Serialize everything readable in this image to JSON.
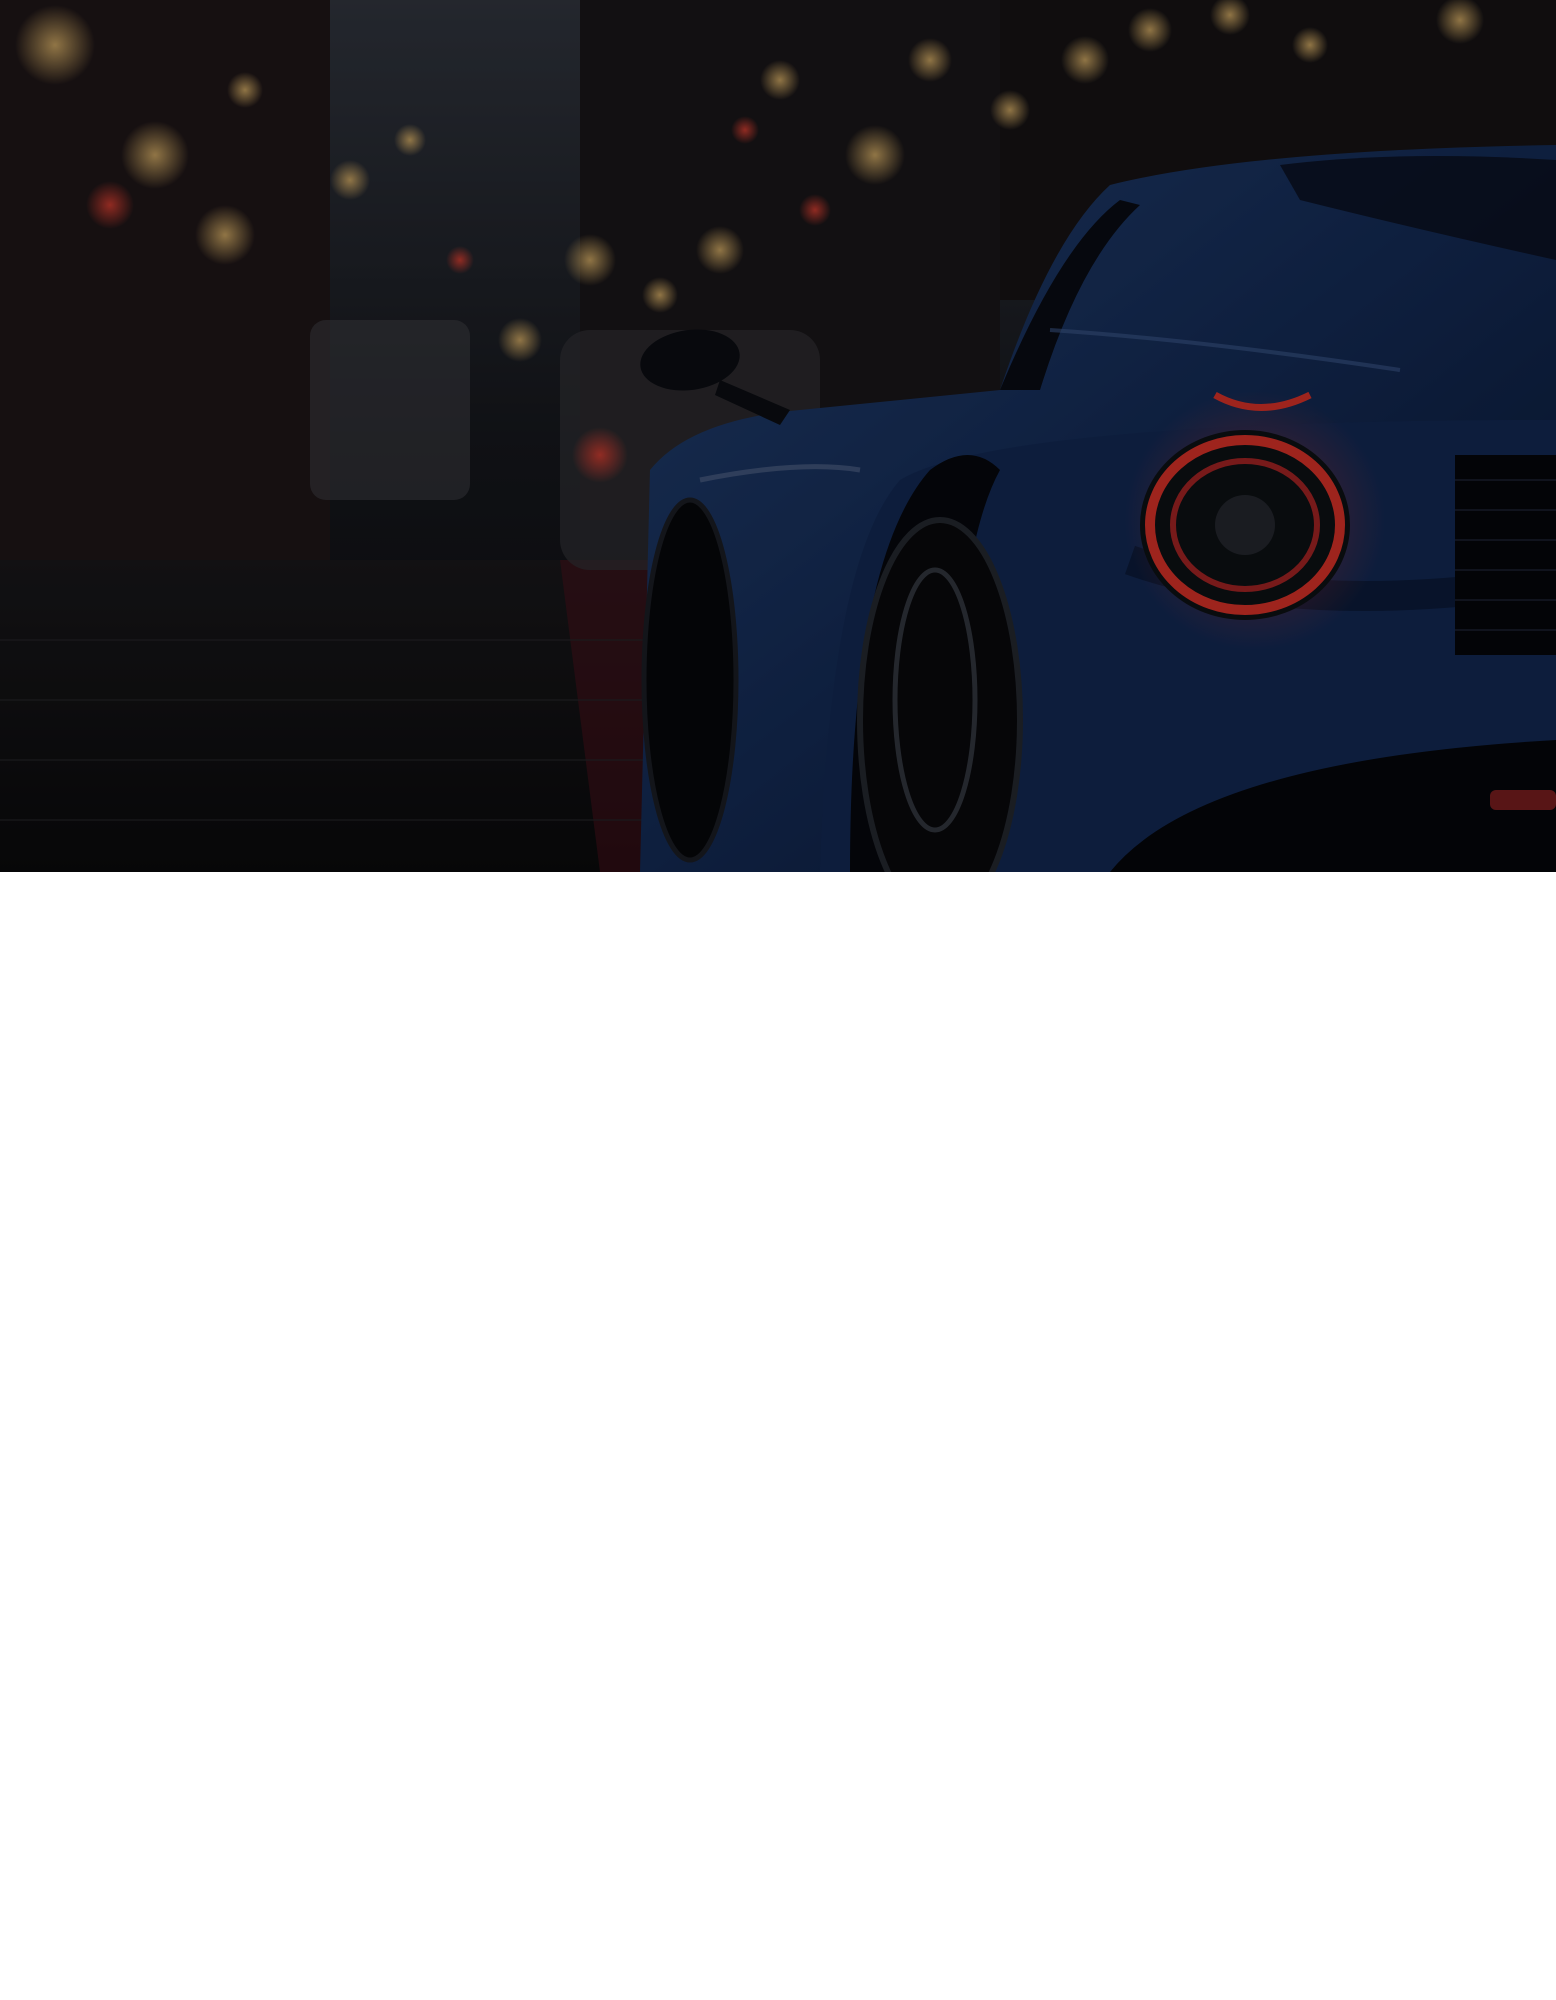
{
  "page": {
    "background": "#ffffff"
  },
  "hero": {
    "image_subject": "blue-sports-car-rear-on-wet-cobblestone-street-at-night",
    "overlay_color": "#000000",
    "car_color": "#1d3f7a",
    "taillight_color": "#ff3b30",
    "bokeh_color": "#e8a64a"
  }
}
